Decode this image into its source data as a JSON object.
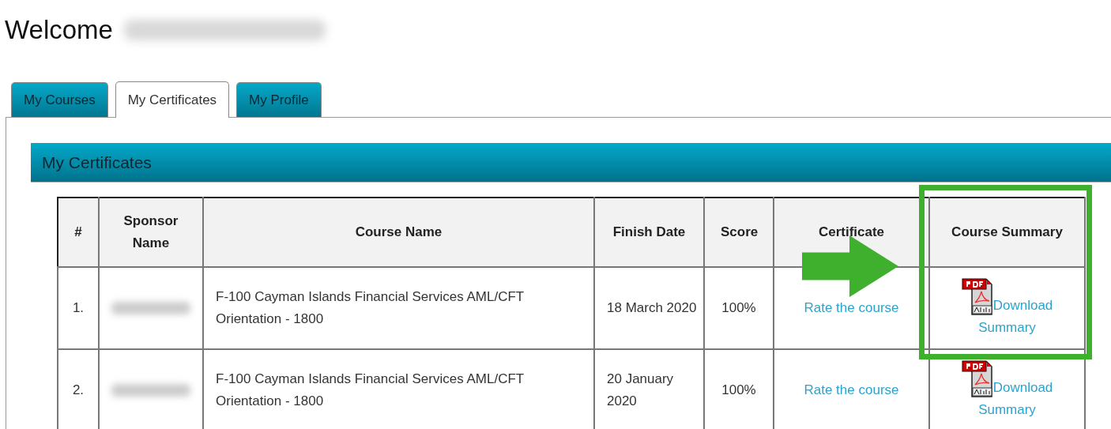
{
  "welcome": {
    "text": "Welcome"
  },
  "tabs": [
    {
      "label": "My Courses",
      "selected": false
    },
    {
      "label": "My Certificates",
      "selected": true
    },
    {
      "label": "My Profile",
      "selected": false
    }
  ],
  "panel": {
    "title": "My Certificates"
  },
  "table": {
    "columns": [
      "#",
      "Sponsor Name",
      "Course Name",
      "Finish Date",
      "Score",
      "Certificate",
      "Course Summary"
    ],
    "rows": [
      {
        "number": "1.",
        "course": "F-100 Cayman Islands Financial Services AML/CFT Orientation - 1800",
        "finish_date": "18 March 2020",
        "score": "100%",
        "certificate": "Rate the course",
        "summary": "Download Summary"
      },
      {
        "number": "2.",
        "course": "F-100 Cayman Islands Financial Services AML/CFT Orientation - 1800",
        "finish_date": "20 January 2020",
        "score": "100%",
        "certificate": "Rate the course",
        "summary": "Download Summary"
      }
    ]
  }
}
